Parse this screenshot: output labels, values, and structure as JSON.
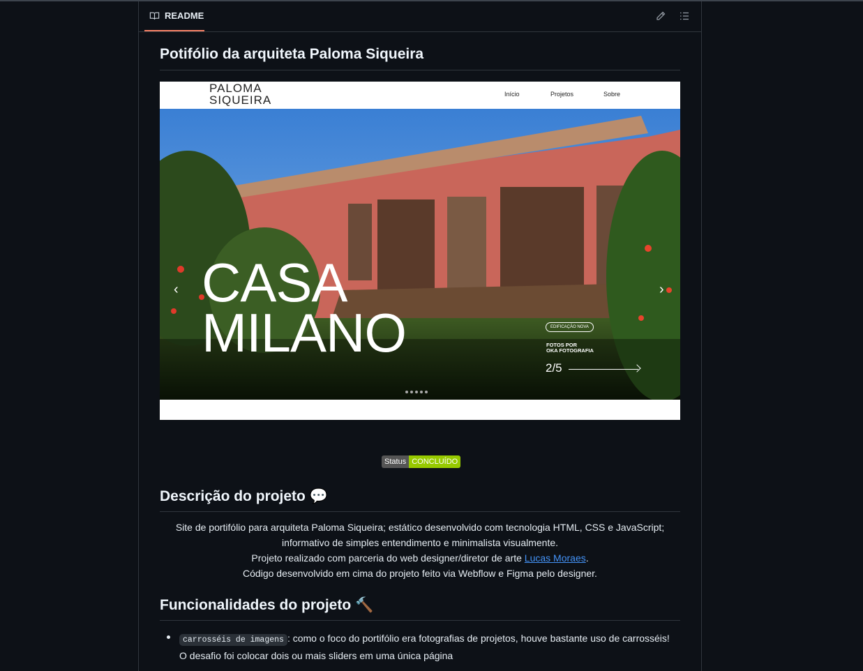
{
  "readme": {
    "tab_label": "README",
    "icons": {
      "book": "book-icon",
      "edit": "pencil-icon",
      "toc": "list-icon"
    }
  },
  "title": "Potifólio da arquiteta Paloma Siqueira",
  "screenshot": {
    "logo_line1": "PALOMA",
    "logo_line2": "SIQUEIRA",
    "nav": [
      "Início",
      "Projetos",
      "Sobre"
    ],
    "hero_line1": "CASA",
    "hero_line2": "MILANO",
    "badge": "EDIFICAÇÃO NOVA",
    "credit_line1": "FOTOS POR",
    "credit_line2": "OKA FOTOGRAFIA",
    "counter": "2/5",
    "prev": "‹",
    "next": "›",
    "dot_count": 5
  },
  "status": {
    "label": "Status",
    "value": "CONCLUÍDO",
    "color": "#97ca00"
  },
  "description": {
    "heading": "Descrição do projeto",
    "heading_emoji": "💬",
    "line1": "Site de portifólio para arquiteta Paloma Siqueira; estático desenvolvido com tecnologia HTML, CSS e JavaScript;",
    "line2": "informativo de simples entendimento e minimalista visualmente.",
    "line3_prefix": "Projeto realizado com parceria do web designer/diretor de arte ",
    "line3_link": "Lucas Moraes",
    "line3_suffix": ".",
    "line4": "Código desenvolvido em cima do projeto feito via Webflow e Figma pelo designer."
  },
  "features": {
    "heading": "Funcionalidades do projeto",
    "heading_emoji": "🔨",
    "items": [
      {
        "code": "carrosséis de imagens",
        "text": ": como o foco do portifólio era fotografias de projetos, houve bastante uso de carrosséis!",
        "text2": "O desafio foi colocar dois ou mais sliders em uma única página"
      }
    ]
  }
}
